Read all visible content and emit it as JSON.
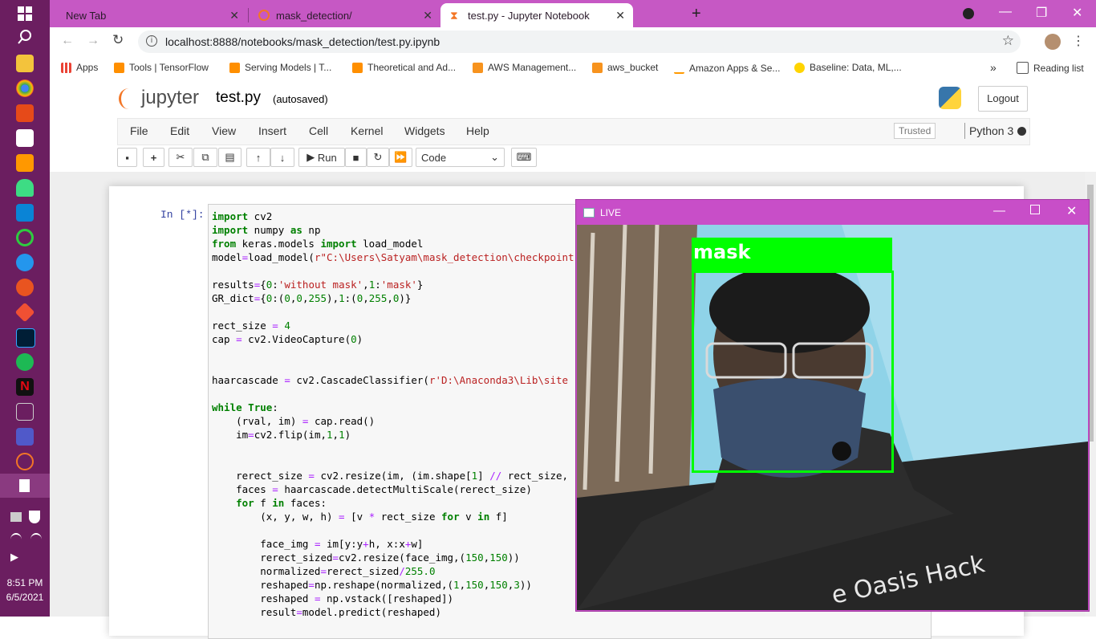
{
  "taskbar": {
    "icons": [
      "start-icon",
      "search-icon",
      "file-explorer-icon",
      "chrome-icon",
      "office-icon",
      "code-icon",
      "sublime-icon",
      "android-icon",
      "vscode-icon",
      "circle-icon",
      "docker-icon",
      "ubuntu-icon",
      "git-icon",
      "photoshop-icon",
      "spotify-icon",
      "netflix-icon",
      "prime-video-icon",
      "teams-icon",
      "jupyter-icon",
      "notepad-icon"
    ],
    "time": "8:51 PM",
    "date": "6/5/2021"
  },
  "browser": {
    "tabs": [
      {
        "label": "New Tab"
      },
      {
        "label": "mask_detection/"
      },
      {
        "label": "test.py - Jupyter Notebook"
      }
    ],
    "url": "localhost:8888/notebooks/mask_detection/test.py.ipynb",
    "bookmarks": [
      "Apps",
      "Tools | TensorFlow",
      "Serving Models | T...",
      "Theoretical and Ad...",
      "AWS Management...",
      "aws_bucket",
      "Amazon Apps & Se...",
      "Baseline: Data, ML,..."
    ],
    "reading_list": "Reading list"
  },
  "jupyter": {
    "logo": "jupyter",
    "notebook_name": "test.py",
    "status": "(autosaved)",
    "logout": "Logout",
    "menu": [
      "File",
      "Edit",
      "View",
      "Insert",
      "Cell",
      "Kernel",
      "Widgets",
      "Help"
    ],
    "trusted": "Trusted",
    "kernel": "Python 3",
    "run_label": "Run",
    "cell_type": "Code",
    "prompt": "In [*]:"
  },
  "live_window": {
    "title": "LIVE",
    "label": "mask",
    "box_color": "#00ff00",
    "shirt_text": "e Oasis Hack"
  },
  "colors": {
    "taskbar": "#6b1e60",
    "tabstrip": "#c658c4",
    "live_title": "#c84ec8"
  }
}
